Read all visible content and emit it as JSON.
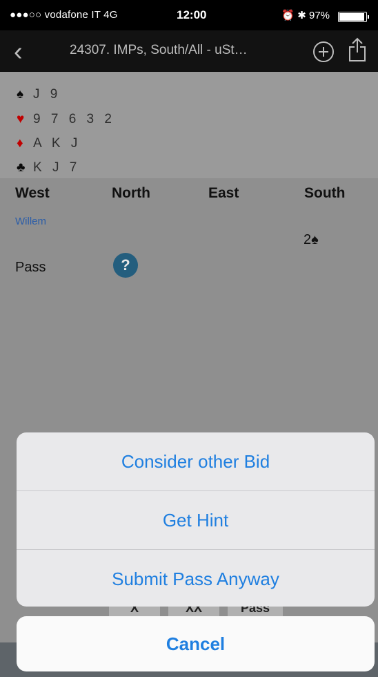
{
  "status_bar": {
    "carrier": "●●●○○ vodafone IT  4G",
    "time": "12:00",
    "right": "⏰ ✱ 97%",
    "battery_level": 0.97
  },
  "nav": {
    "back_icon": "chevron-left-icon",
    "title": "24307. IMPs, South/All - uSt…"
  },
  "hand": {
    "spades": "J 9",
    "hearts": "9 7 6 3 2",
    "diamonds": "A K J",
    "clubs": "K J 7"
  },
  "auction": {
    "headers": [
      "West",
      "North",
      "East",
      "South"
    ],
    "west_player": "Willem",
    "south_bid": "2♠",
    "west_bid": "Pass"
  },
  "bidbox": [
    "X",
    "XX",
    "Pass"
  ],
  "action_sheet": {
    "items": [
      "Consider other Bid",
      "Get Hint",
      "Submit Pass Anyway"
    ],
    "cancel": "Cancel"
  },
  "colors": {
    "accent": "#1f7fe0",
    "heart_diamond": "#c00000",
    "hint_icon": "#245e7e"
  }
}
